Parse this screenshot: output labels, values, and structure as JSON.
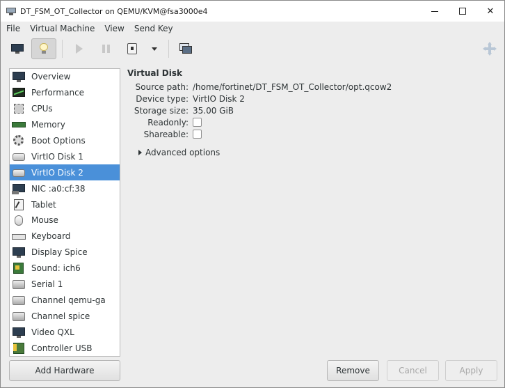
{
  "window": {
    "title": "DT_FSM_OT_Collector on QEMU/KVM@fsa3000e4",
    "minimize_icon": "minimize-icon",
    "maximize_icon": "maximize-icon",
    "close_label": "✕"
  },
  "menubar": {
    "items": [
      "File",
      "Virtual Machine",
      "View",
      "Send Key"
    ]
  },
  "toolbar": {
    "icons": [
      "monitor-icon",
      "lightbulb-icon",
      "play-icon",
      "pause-icon",
      "power-icon",
      "chevron-down-icon",
      "snapshot-icon",
      "fullscreen-icon"
    ]
  },
  "sidebar": {
    "selected_index": 6,
    "items": [
      {
        "label": "Overview",
        "icon": "monitor-icon"
      },
      {
        "label": "Performance",
        "icon": "chart-icon"
      },
      {
        "label": "CPUs",
        "icon": "chip-icon"
      },
      {
        "label": "Memory",
        "icon": "memory-icon"
      },
      {
        "label": "Boot Options",
        "icon": "gear-icon"
      },
      {
        "label": "VirtIO Disk 1",
        "icon": "disk-icon"
      },
      {
        "label": "VirtIO Disk 2",
        "icon": "disk-icon"
      },
      {
        "label": "NIC :a0:cf:38",
        "icon": "network-icon"
      },
      {
        "label": "Tablet",
        "icon": "tablet-icon"
      },
      {
        "label": "Mouse",
        "icon": "mouse-icon"
      },
      {
        "label": "Keyboard",
        "icon": "keyboard-icon"
      },
      {
        "label": "Display Spice",
        "icon": "monitor-icon"
      },
      {
        "label": "Sound: ich6",
        "icon": "sound-card-icon"
      },
      {
        "label": "Serial 1",
        "icon": "serial-icon"
      },
      {
        "label": "Channel qemu-ga",
        "icon": "serial-icon"
      },
      {
        "label": "Channel spice",
        "icon": "serial-icon"
      },
      {
        "label": "Video QXL",
        "icon": "monitor-icon"
      },
      {
        "label": "Controller USB",
        "icon": "controller-icon"
      }
    ]
  },
  "details": {
    "section_title": "Virtual Disk",
    "source_path_label": "Source path:",
    "source_path": "/home/fortinet/DT_FSM_OT_Collector/opt.qcow2",
    "device_type_label": "Device type:",
    "device_type": "VirtIO Disk 2",
    "storage_size_label": "Storage size:",
    "storage_size": "35.00 GiB",
    "readonly_label": "Readonly:",
    "readonly": false,
    "shareable_label": "Shareable:",
    "shareable": false,
    "advanced_label": "Advanced options"
  },
  "buttons": {
    "add_hardware": "Add Hardware",
    "remove": "Remove",
    "cancel": "Cancel",
    "apply": "Apply"
  }
}
